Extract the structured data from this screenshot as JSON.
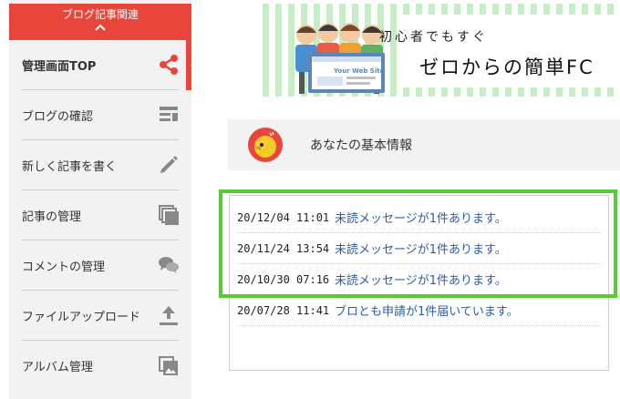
{
  "sidebar": {
    "header_label": "ブログ記事関連",
    "items": [
      {
        "label": "管理画面TOP",
        "icon": "share-icon",
        "active": true
      },
      {
        "label": "ブログの確認",
        "icon": "article-icon",
        "active": false
      },
      {
        "label": "新しく記事を書く",
        "icon": "pencil-icon",
        "active": false
      },
      {
        "label": "記事の管理",
        "icon": "stacked-pages-icon",
        "active": false
      },
      {
        "label": "コメントの管理",
        "icon": "speech-bubbles-icon",
        "active": false
      },
      {
        "label": "ファイルアップロード",
        "icon": "upload-icon",
        "active": false
      },
      {
        "label": "アルバム管理",
        "icon": "photo-album-icon",
        "active": false
      }
    ]
  },
  "banner": {
    "line1": "初心者でもすぐ",
    "line2": "ゼロからの簡単FC",
    "screen_label": "Your Web Site"
  },
  "info": {
    "title": "あなたの基本情報"
  },
  "notifications": [
    {
      "date": "20/12/04 11:01",
      "message": "未読メッセージが1件あります。"
    },
    {
      "date": "20/11/24 13:54",
      "message": "未読メッセージが1件あります。"
    },
    {
      "date": "20/10/30 07:16",
      "message": "未読メッセージが1件あります。"
    },
    {
      "date": "20/07/28 11:41",
      "message": "ブロとも申請が1件届いています。"
    }
  ],
  "colors": {
    "accent": "#e8463a",
    "highlight": "#55cc33",
    "link": "#2a5caa",
    "banner_stripe": "#c8ecc8"
  }
}
